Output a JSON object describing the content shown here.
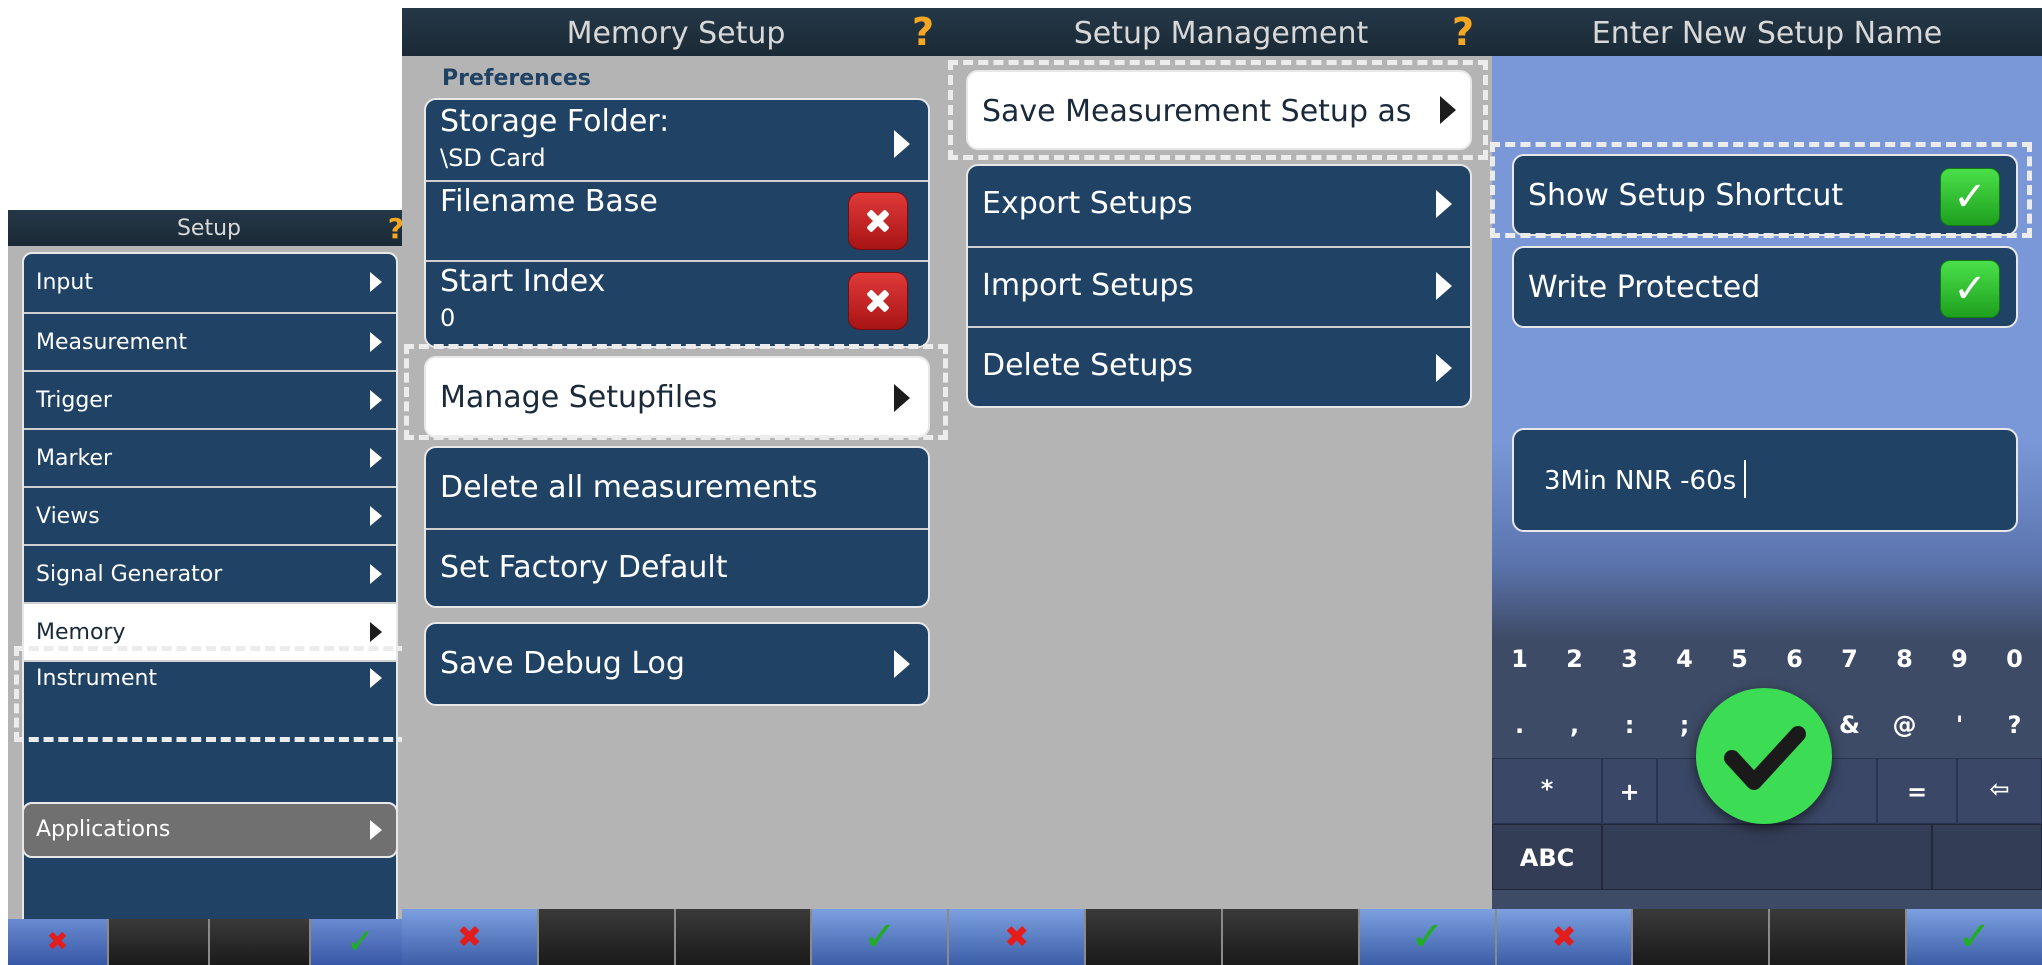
{
  "setup": {
    "title": "Setup",
    "help_icon": "?",
    "items": [
      {
        "label": "Input"
      },
      {
        "label": "Measurement"
      },
      {
        "label": "Trigger"
      },
      {
        "label": "Marker"
      },
      {
        "label": "Views"
      },
      {
        "label": "Signal Generator"
      },
      {
        "label": "Memory",
        "selected": true
      },
      {
        "label": "Instrument"
      }
    ],
    "applications": "Applications"
  },
  "memory_setup": {
    "title": "Memory Setup",
    "help_icon": "?",
    "section": "Preferences",
    "storage_folder": {
      "label": "Storage Folder:",
      "value": "\\SD Card"
    },
    "filename_base": {
      "label": "Filename Base"
    },
    "start_index": {
      "label": "Start Index",
      "value": "0"
    },
    "manage_setupfiles": "Manage Setupfiles",
    "delete_all": "Delete all measurements",
    "factory_default": "Set Factory Default",
    "save_debug_log": "Save Debug Log"
  },
  "setup_management": {
    "title": "Setup Management",
    "help_icon": "?",
    "save_as": "Save Measurement Setup as",
    "export": "Export Setups",
    "import": "Import Setups",
    "delete": "Delete Setups"
  },
  "new_setup_name": {
    "title": "Enter New Setup Name",
    "show_shortcut": {
      "label": "Show Setup Shortcut",
      "checked": true
    },
    "write_protected": {
      "label": "Write Protected",
      "checked": true
    },
    "name_value": "3Min NNR -60s",
    "keyboard": {
      "row1": [
        "1",
        "2",
        "3",
        "4",
        "5",
        "6",
        "7",
        "8",
        "9",
        "0"
      ],
      "row2": [
        ".",
        ",",
        ":",
        ";",
        "!",
        "?",
        "&",
        "@",
        "'",
        "?"
      ],
      "row3": [
        "*",
        "+",
        "=",
        "⇦"
      ],
      "mode_key": "ABC"
    }
  },
  "softkeys": {
    "cancel_glyph": "✖",
    "confirm_glyph": "✓"
  },
  "colors": {
    "item_bg": "#1f4265",
    "panel_bg": "#b4b4b4",
    "accent_orange": "#f5a623",
    "cancel_red": "#e31c1c",
    "confirm_green": "#1fae1f",
    "highlight": "#ffffff"
  }
}
